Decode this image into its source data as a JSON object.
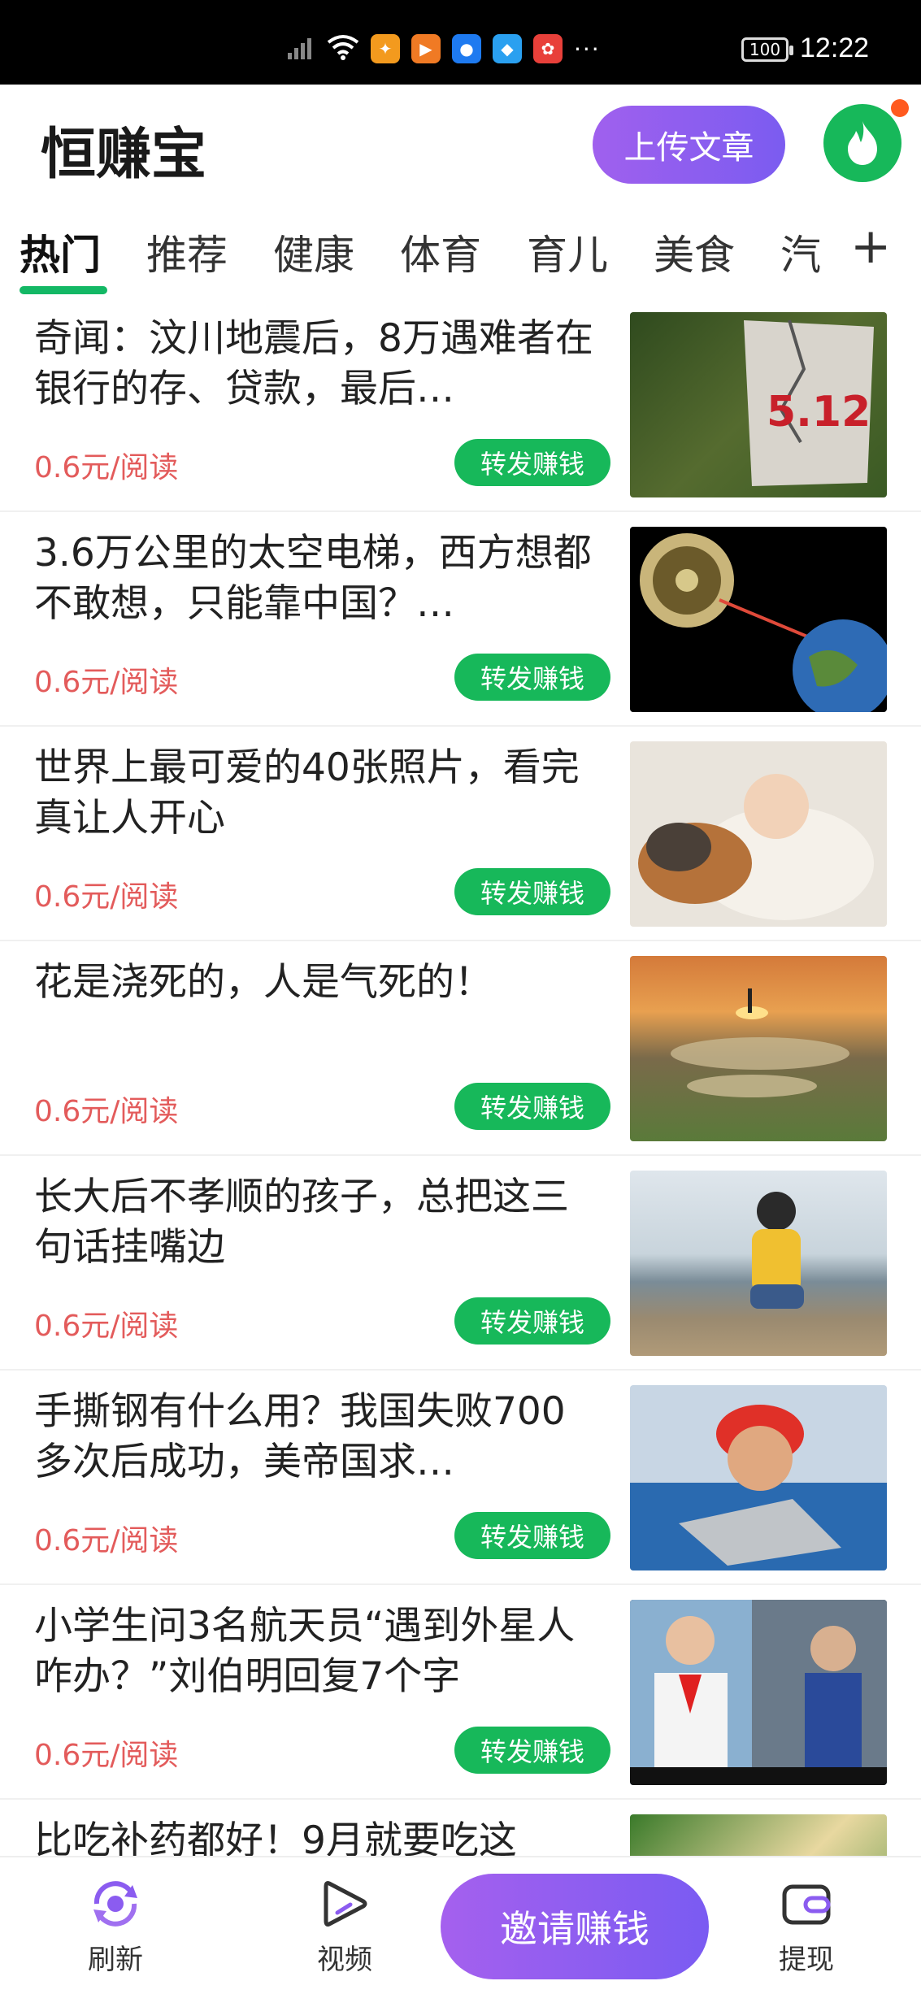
{
  "status_bar": {
    "battery": "100",
    "time": "12:22",
    "more": "···"
  },
  "header": {
    "app_title": "恒赚宝",
    "upload_button": "上传文章"
  },
  "tabs": [
    "热门",
    "推荐",
    "健康",
    "体育",
    "育儿",
    "美食",
    "汽"
  ],
  "tab_add": "+",
  "articles": [
    {
      "title": "奇闻：汶川地震后，8万遇难者在银行的存、贷款，最后…",
      "price": "0.6元/阅读",
      "share": "转发赚钱",
      "thumb_text": "5.12"
    },
    {
      "title": "3.6万公里的太空电梯，西方想都不敢想，只能靠中国？…",
      "price": "0.6元/阅读",
      "share": "转发赚钱"
    },
    {
      "title": "世界上最可爱的40张照片，看完真让人开心",
      "price": "0.6元/阅读",
      "share": "转发赚钱"
    },
    {
      "title": "花是浇死的，人是气死的！",
      "price": "0.6元/阅读",
      "share": "转发赚钱"
    },
    {
      "title": "长大后不孝顺的孩子，总把这三句话挂嘴边",
      "price": "0.6元/阅读",
      "share": "转发赚钱"
    },
    {
      "title": "手撕钢有什么用？我国失败700多次后成功，美帝国求…",
      "price": "0.6元/阅读",
      "share": "转发赚钱"
    },
    {
      "title": "小学生问3名航天员“遇到外星人咋办？”刘伯明回复7个字",
      "price": "0.6元/阅读",
      "share": "转发赚钱"
    },
    {
      "title": "比吃补药都好！9月就要吃这",
      "price": "",
      "share": ""
    }
  ],
  "bottom_nav": {
    "refresh": "刷新",
    "video": "视频",
    "invite": "邀请赚钱",
    "withdraw": "提现"
  },
  "colors": {
    "accent_green": "#17b85a",
    "accent_purple": "#8b5cf0",
    "price_red": "#e35b5b"
  }
}
